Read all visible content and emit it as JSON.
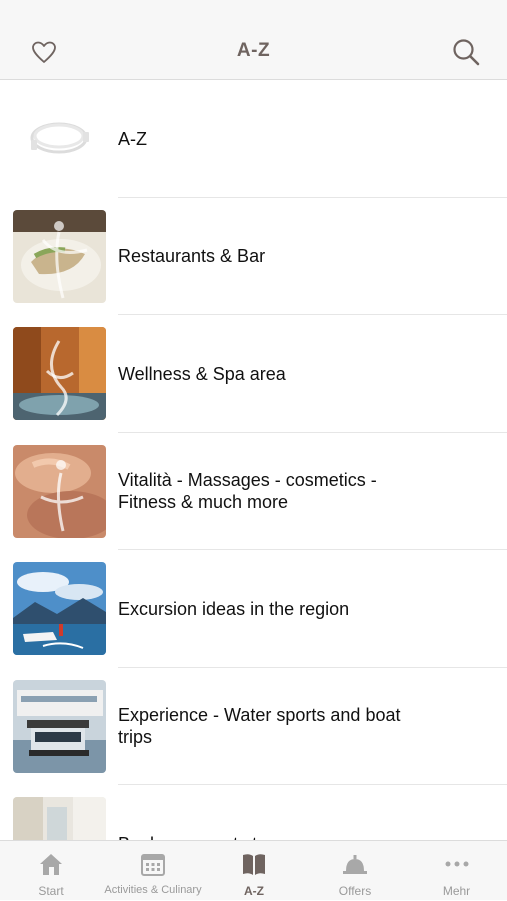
{
  "header": {
    "title": "A-Z",
    "favorite_icon": "heart-icon",
    "search_icon": "search-icon"
  },
  "list": {
    "items": [
      {
        "label": "A-Z",
        "thumb": "cable-image"
      },
      {
        "label": "Restaurants & Bar",
        "thumb": "restaurant-image"
      },
      {
        "label": "Wellness & Spa area",
        "thumb": "wellness-image"
      },
      {
        "label": "Vitalità - Massages - cosmetics - Fitness & much more",
        "thumb": "massage-image"
      },
      {
        "label": "Excursion ideas in the region",
        "thumb": "lake-image"
      },
      {
        "label": "Experience - Water sports and boat trips",
        "thumb": "boat-image"
      },
      {
        "label": "Book your next stay",
        "thumb": "room-image"
      }
    ]
  },
  "tabbar": {
    "tabs": [
      {
        "label": "Start",
        "icon": "home-icon",
        "active": false
      },
      {
        "label": "Activities & Culinary",
        "icon": "calendar-icon",
        "active": false
      },
      {
        "label": "A-Z",
        "icon": "book-icon",
        "active": true
      },
      {
        "label": "Offers",
        "icon": "bell-icon",
        "active": false
      },
      {
        "label": "Mehr",
        "icon": "more-icon",
        "active": false
      }
    ]
  },
  "colors": {
    "accent": "#6f6460",
    "inactive": "#9a9a9a",
    "bar_bg": "#f7f7f7"
  }
}
